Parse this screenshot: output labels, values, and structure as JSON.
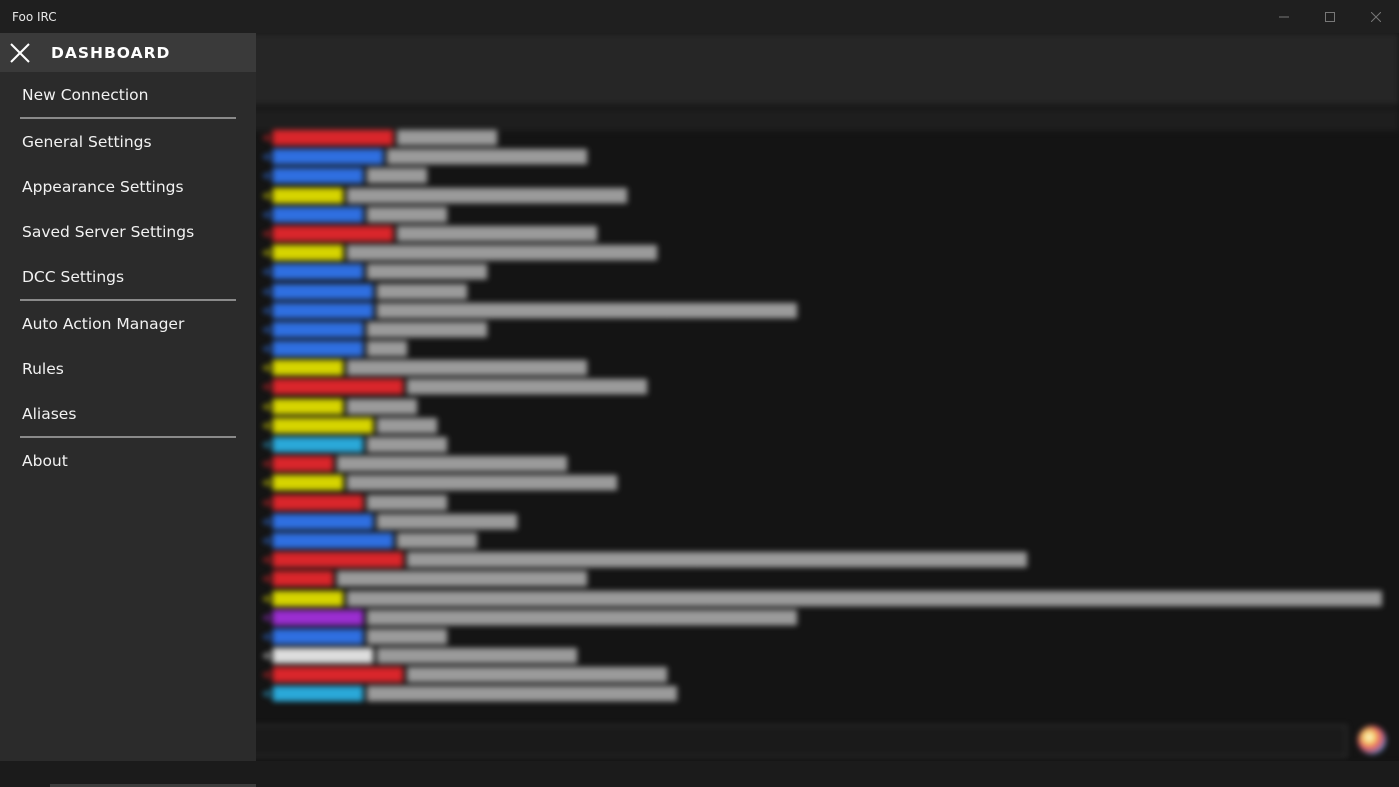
{
  "window": {
    "title": "Foo IRC",
    "controls": [
      "minimize",
      "maximize",
      "close"
    ]
  },
  "dashboard": {
    "title": "DASHBOARD",
    "groups": [
      [
        {
          "label": "New Connection"
        }
      ],
      [
        {
          "label": "General Settings"
        },
        {
          "label": "Appearance Settings"
        },
        {
          "label": "Saved Server Settings"
        },
        {
          "label": "DCC Settings"
        }
      ],
      [
        {
          "label": "Auto Action Manager"
        },
        {
          "label": "Rules"
        },
        {
          "label": "Aliases"
        }
      ],
      [
        {
          "label": "About"
        }
      ]
    ]
  },
  "colors": {
    "dashboard_bg": "#2b2b2b",
    "dashboard_header_bg": "#3a3a3a",
    "separator": "#8a8a8a",
    "nick_red": "#d9262b",
    "nick_blue": "#2f6fe0",
    "nick_yellow": "#d6d400",
    "nick_cyan": "#2aa8d8",
    "nick_purple": "#9a2ed0"
  }
}
